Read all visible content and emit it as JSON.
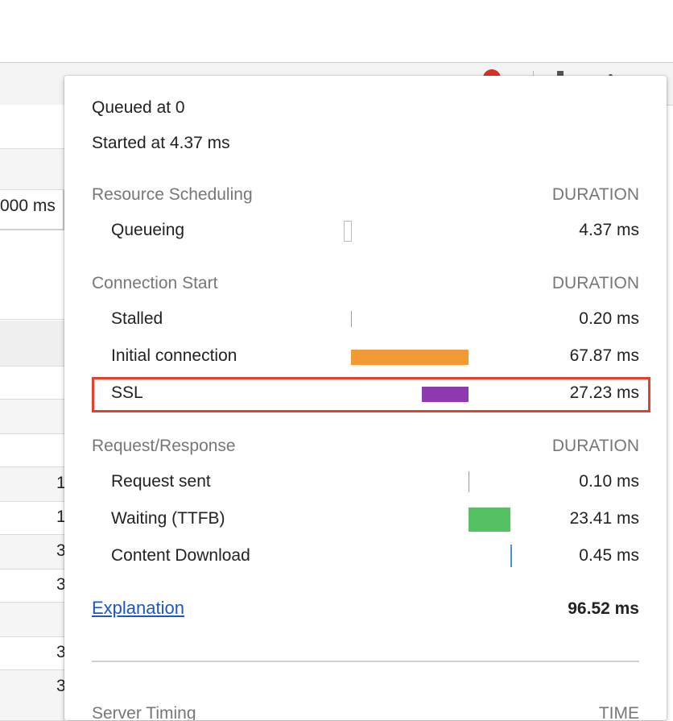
{
  "background": {
    "partial_duration": "000 ms",
    "row_numbers": [
      "1",
      "1",
      "3",
      "3",
      "3",
      "3"
    ]
  },
  "popover": {
    "queued_at": "Queued at 0",
    "started_at": "Started at 4.37 ms",
    "sections": [
      {
        "title": "Resource Scheduling",
        "column_header": "DURATION",
        "rows": [
          {
            "label": "Queueing",
            "value": "4.37 ms"
          }
        ]
      },
      {
        "title": "Connection Start",
        "column_header": "DURATION",
        "rows": [
          {
            "label": "Stalled",
            "value": "0.20 ms"
          },
          {
            "label": "Initial connection",
            "value": "67.87 ms",
            "color": "#f29b34"
          },
          {
            "label": "SSL",
            "value": "27.23 ms",
            "color": "#8e3ab0",
            "highlighted": true
          }
        ]
      },
      {
        "title": "Request/Response",
        "column_header": "DURATION",
        "rows": [
          {
            "label": "Request sent",
            "value": "0.10 ms"
          },
          {
            "label": "Waiting (TTFB)",
            "value": "23.41 ms",
            "color": "#54c162"
          },
          {
            "label": "Content Download",
            "value": "0.45 ms",
            "color": "#4a90d9"
          }
        ]
      }
    ],
    "explanation_link": "Explanation",
    "total": "96.52 ms",
    "server_timing": {
      "title": "Server Timing",
      "column_header": "TIME"
    }
  },
  "colors": {
    "highlight_border": "#e4402c",
    "link": "#1a56c8"
  }
}
